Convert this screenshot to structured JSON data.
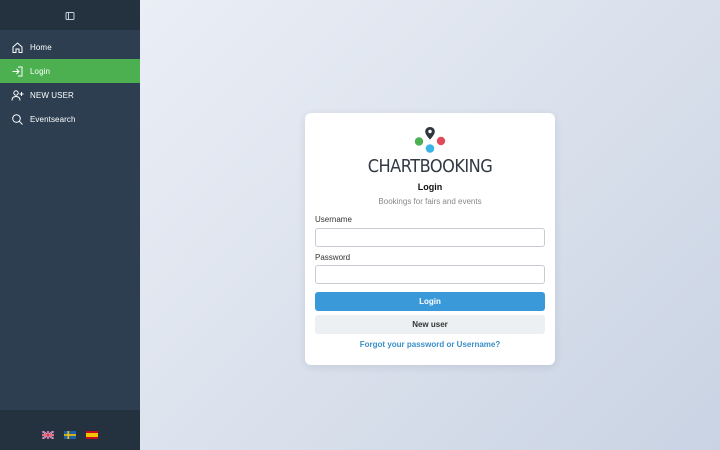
{
  "sidebar": {
    "toggle_icon": "sidebar-toggle-icon",
    "items": [
      {
        "label": "Home",
        "icon": "home-icon",
        "active": false
      },
      {
        "label": "Login",
        "icon": "login-icon",
        "active": true
      },
      {
        "label": "NEW USER",
        "icon": "add-user-icon",
        "active": false
      },
      {
        "label": "Eventsearch",
        "icon": "search-icon",
        "active": false
      }
    ],
    "languages": [
      "uk-flag-icon",
      "sweden-flag-icon",
      "spain-flag-icon"
    ],
    "active_color": "#4caf50",
    "background": "#2c3e50"
  },
  "card": {
    "brand": "CHARTBOOKING",
    "title": "Login",
    "subtitle": "Bookings for fairs and events",
    "username_label": "Username",
    "username_value": "",
    "password_label": "Password",
    "password_value": "",
    "login_button": "Login",
    "new_user_button": "New user",
    "forgot_link": "Forgot your password or Username?",
    "logo_colors": {
      "pin": "#2f3640",
      "green": "#4caf50",
      "red": "#e04b5a",
      "blue": "#3bb4e5"
    },
    "primary_color": "#3a9ad9"
  }
}
